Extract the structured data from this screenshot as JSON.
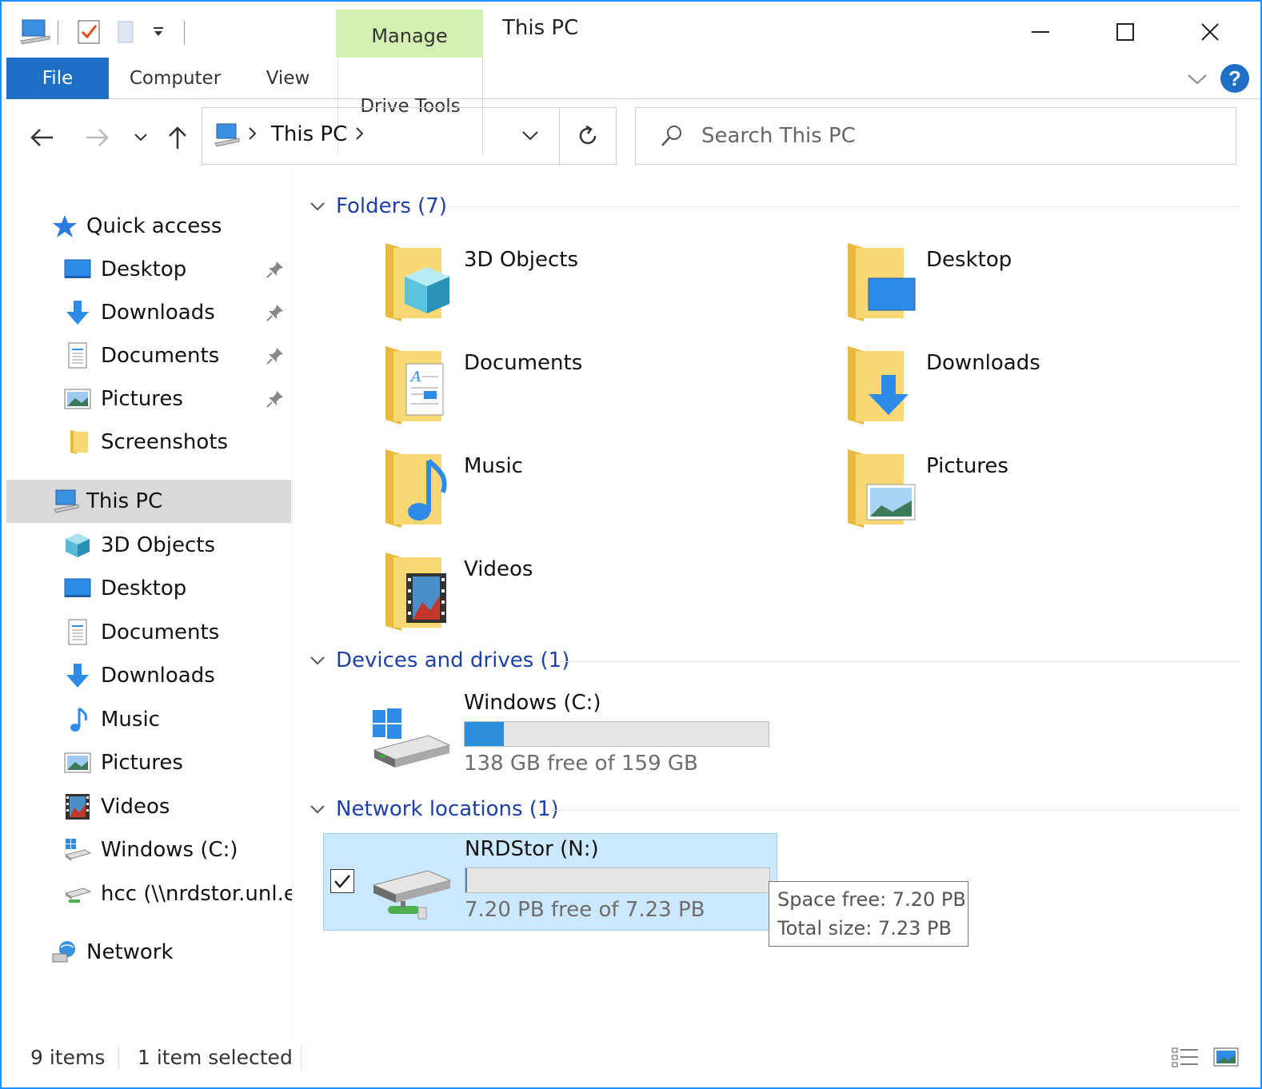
{
  "window": {
    "title": "This PC",
    "ribbon_context_tab": "Manage",
    "accent_color": "#1f6fc4"
  },
  "ribbon": {
    "tabs": [
      {
        "label": "File"
      },
      {
        "label": "Computer"
      },
      {
        "label": "View"
      },
      {
        "label": "Drive Tools"
      }
    ]
  },
  "address_bar": {
    "location": "This PC",
    "search_placeholder": "Search This PC"
  },
  "sidebar": {
    "quick_access": "Quick access",
    "quick_items": [
      {
        "label": "Desktop",
        "icon": "desktop-icon",
        "pinned": true
      },
      {
        "label": "Downloads",
        "icon": "downloads-icon",
        "pinned": true
      },
      {
        "label": "Documents",
        "icon": "documents-icon",
        "pinned": true
      },
      {
        "label": "Pictures",
        "icon": "pictures-icon",
        "pinned": true
      },
      {
        "label": "Screenshots",
        "icon": "folder-icon",
        "pinned": false
      }
    ],
    "this_pc": "This PC",
    "pc_items": [
      {
        "label": "3D Objects",
        "icon": "3d-objects-icon"
      },
      {
        "label": "Desktop",
        "icon": "desktop-icon"
      },
      {
        "label": "Documents",
        "icon": "documents-icon"
      },
      {
        "label": "Downloads",
        "icon": "downloads-icon"
      },
      {
        "label": "Music",
        "icon": "music-icon"
      },
      {
        "label": "Pictures",
        "icon": "pictures-icon"
      },
      {
        "label": "Videos",
        "icon": "videos-icon"
      },
      {
        "label": "Windows (C:)",
        "icon": "windows-drive-icon"
      },
      {
        "label": "hcc (\\\\nrdstor.unl.ec",
        "icon": "network-drive-icon"
      }
    ],
    "network": "Network"
  },
  "content": {
    "folders_header": "Folders (7)",
    "folders": [
      {
        "label": "3D Objects",
        "icon": "3d-objects-folder-icon"
      },
      {
        "label": "Desktop",
        "icon": "desktop-folder-icon"
      },
      {
        "label": "Documents",
        "icon": "documents-folder-icon"
      },
      {
        "label": "Downloads",
        "icon": "downloads-folder-icon"
      },
      {
        "label": "Music",
        "icon": "music-folder-icon"
      },
      {
        "label": "Pictures",
        "icon": "pictures-folder-icon"
      },
      {
        "label": "Videos",
        "icon": "videos-folder-icon"
      }
    ],
    "devices_header": "Devices and drives (1)",
    "drive_c": {
      "name": "Windows (C:)",
      "free_text": "138 GB free of 159 GB",
      "used_fraction": 0.13
    },
    "network_header": "Network locations (1)",
    "drive_n": {
      "name": "NRDStor (N:)",
      "free_text": "7.20 PB free of 7.23 PB",
      "used_fraction": 0.004,
      "selected": true
    },
    "tooltip": {
      "line1": "Space free: 7.20 PB",
      "line2": "Total size: 7.23 PB"
    }
  },
  "status_bar": {
    "items": "9 items",
    "selected": "1 item selected"
  }
}
